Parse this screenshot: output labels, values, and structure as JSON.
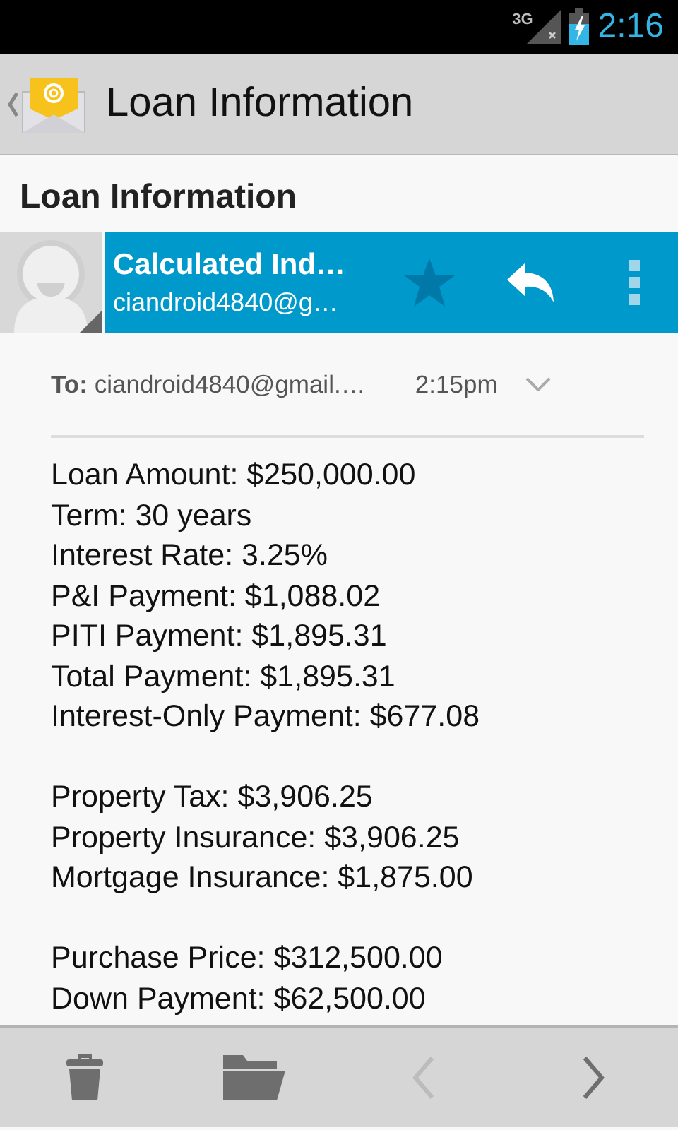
{
  "status_bar": {
    "network": "3G",
    "time": "2:16"
  },
  "action_bar": {
    "title": "Loan Information"
  },
  "subject": "Loan Information",
  "sender": {
    "name": "Calculated Ind…",
    "address": "ciandroid4840@g…",
    "starred": false
  },
  "recipient": {
    "label": "To:",
    "address": "ciandroid4840@gmail.…",
    "time": "2:15pm"
  },
  "body": {
    "paragraphs": [
      [
        "Loan Amount: $250,000.00",
        "Term: 30 years",
        "Interest Rate: 3.25%",
        "P&I Payment: $1,088.02",
        "PITI Payment: $1,895.31",
        "Total Payment: $1,895.31",
        "Interest-Only Payment: $677.08"
      ],
      [
        "Property Tax: $3,906.25",
        "Property Insurance: $3,906.25",
        "Mortgage Insurance: $1,875.00"
      ],
      [
        "Purchase Price: $312,500.00",
        "Down Payment: $62,500.00"
      ]
    ]
  },
  "bottom_bar": {
    "previous_disabled": true,
    "next_disabled": false
  }
}
